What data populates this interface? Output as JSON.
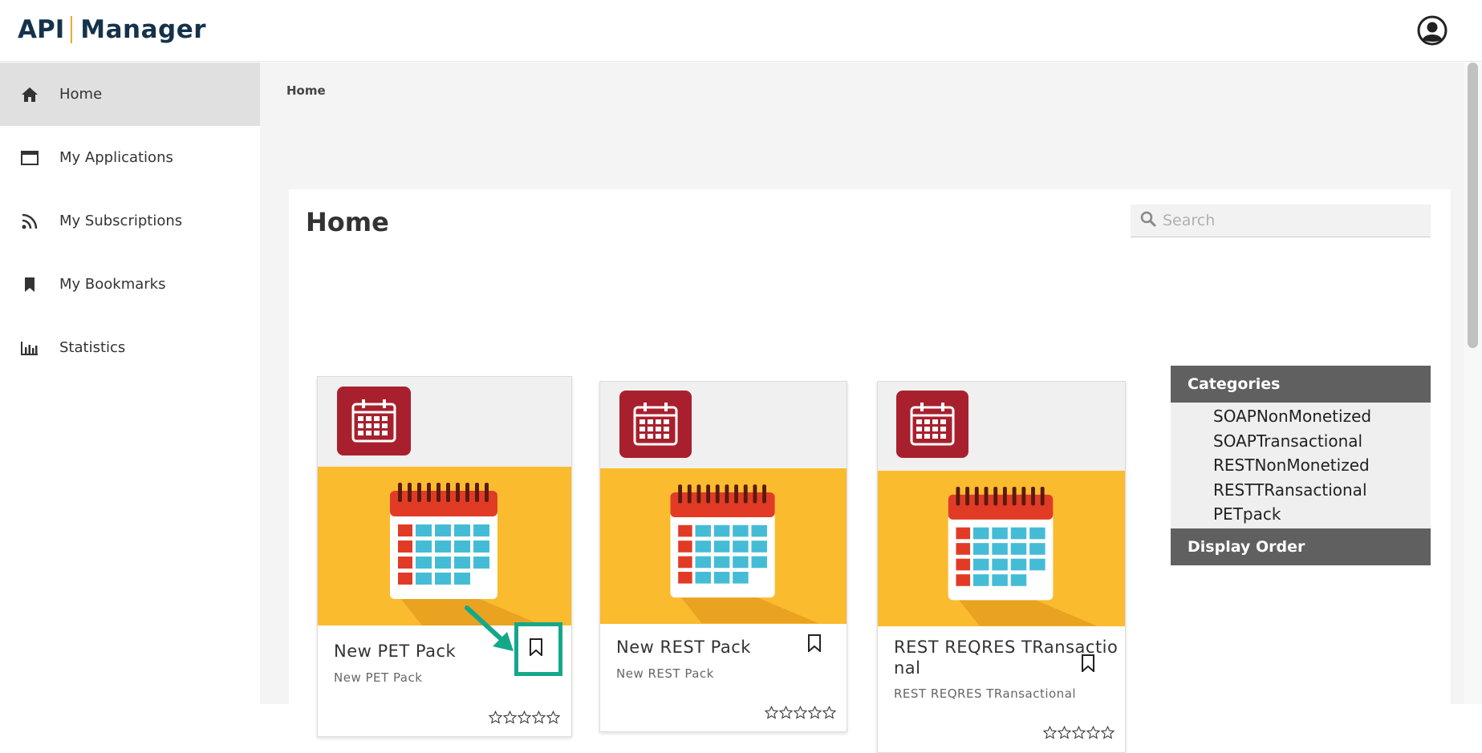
{
  "header": {
    "logo_api": "API",
    "logo_manager": "Manager"
  },
  "sidebar": {
    "items": [
      {
        "label": "Home",
        "icon": "home-icon",
        "active": true
      },
      {
        "label": "My Applications",
        "icon": "window-icon",
        "active": false
      },
      {
        "label": "My Subscriptions",
        "icon": "rss-icon",
        "active": false
      },
      {
        "label": "My Bookmarks",
        "icon": "bookmark-icon",
        "active": false
      },
      {
        "label": "Statistics",
        "icon": "bar-chart-icon",
        "active": false
      }
    ]
  },
  "breadcrumb": "Home",
  "main": {
    "title": "Home",
    "search_placeholder": "Search"
  },
  "cards": [
    {
      "title": "New PET Pack",
      "subtitle": "New PET Pack",
      "rating": 0
    },
    {
      "title": "New REST Pack",
      "subtitle": "New REST Pack",
      "rating": 0
    },
    {
      "title_line1": "REST REQRES TRansactio",
      "title_line2": "nal",
      "subtitle": "REST REQRES TRansactional",
      "rating": 0
    }
  ],
  "categories": {
    "heading": "Categories",
    "items": [
      "SOAPNonMonetized",
      "SOAPTransactional",
      "RESTNonMonetized",
      "RESTTRansactional",
      "PETpack"
    ],
    "display_order_heading": "Display Order"
  },
  "colors": {
    "accent_highlight": "#14a88a",
    "banner_yellow": "#fbbb2e",
    "icon_red": "#a8202e",
    "category_header": "#606060"
  }
}
